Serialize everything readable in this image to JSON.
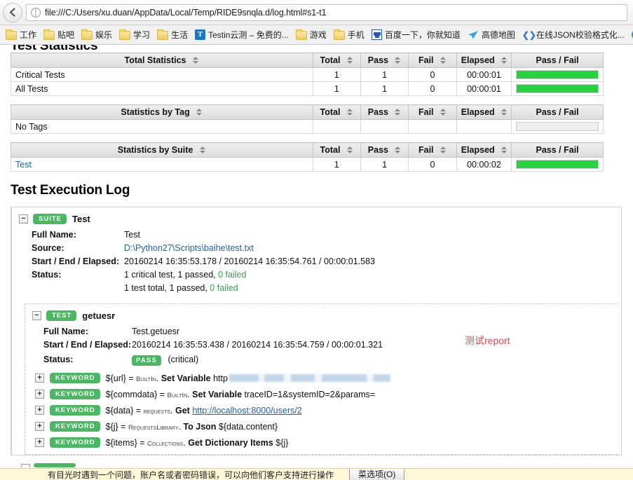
{
  "browser": {
    "back_button": "back-arrow",
    "url": "file:///C:/Users/xu.duan/AppData/Local/Temp/RIDE9snqla.d/log.html#s1-t1",
    "bookmarks": [
      {
        "label": "工作",
        "icon": "folder-icon"
      },
      {
        "label": "贴吧",
        "icon": "folder-icon"
      },
      {
        "label": "娱乐",
        "icon": "folder-icon"
      },
      {
        "label": "学习",
        "icon": "folder-icon"
      },
      {
        "label": "生活",
        "icon": "folder-icon"
      },
      {
        "label": "Testin云测 – 免费的...",
        "icon": "testin-icon"
      },
      {
        "label": "游戏",
        "icon": "folder-icon"
      },
      {
        "label": "手机",
        "icon": "folder-icon"
      },
      {
        "label": "百度一下，你就知道",
        "icon": "baidu-icon"
      },
      {
        "label": "高德地图",
        "icon": "amap-icon"
      },
      {
        "label": "在线JSON校验格式化...",
        "icon": "json-icon"
      },
      {
        "label": "",
        "icon": "google-icon"
      }
    ]
  },
  "page": {
    "statistics_title": "Test Statistics",
    "execution_title": "Test Execution Log",
    "annotation": "测试report"
  },
  "tables": [
    {
      "name": "total-statistics",
      "headers": [
        "Total Statistics",
        "Total",
        "Pass",
        "Fail",
        "Elapsed",
        "Pass / Fail"
      ],
      "rows": [
        {
          "name": "Critical Tests",
          "total": "1",
          "pass": "1",
          "fail": "0",
          "elapsed": "00:00:01",
          "pass_pct": 100,
          "link": false
        },
        {
          "name": "All Tests",
          "total": "1",
          "pass": "1",
          "fail": "0",
          "elapsed": "00:00:01",
          "pass_pct": 100,
          "link": false
        }
      ]
    },
    {
      "name": "statistics-by-tag",
      "headers": [
        "Statistics by Tag",
        "Total",
        "Pass",
        "Fail",
        "Elapsed",
        "Pass / Fail"
      ],
      "rows": [
        {
          "name": "No Tags",
          "total": "",
          "pass": "",
          "fail": "",
          "elapsed": "",
          "pass_pct": 0,
          "link": false
        }
      ]
    },
    {
      "name": "statistics-by-suite",
      "headers": [
        "Statistics by Suite",
        "Total",
        "Pass",
        "Fail",
        "Elapsed",
        "Pass / Fail"
      ],
      "rows": [
        {
          "name": "Test",
          "total": "1",
          "pass": "1",
          "fail": "0",
          "elapsed": "00:00:02",
          "pass_pct": 100,
          "link": true
        }
      ]
    }
  ],
  "suite": {
    "badge": "SUITE",
    "name": "Test",
    "expander": "−",
    "labels": {
      "full_name": "Full Name:",
      "source": "Source:",
      "start_end": "Start / End / Elapsed:",
      "status": "Status:"
    },
    "full_name": "Test",
    "source": "D:\\Python27\\Scripts\\baihe\\test.txt",
    "start_end_elapsed": "20160214 16:35:53.178 / 20160214 16:35:54.761 / 00:00:01.583",
    "status_line1_a": "1 critical test, 1 passed, ",
    "status_line1_b": "0 failed",
    "status_line2_a": "1 test total, 1 passed, ",
    "status_line2_b": "0 failed"
  },
  "test": {
    "badge": "TEST",
    "name": "getuesr",
    "expander": "−",
    "labels": {
      "full_name": "Full Name:",
      "start_end": "Start / End / Elapsed:",
      "status": "Status:"
    },
    "full_name": "Test.getuesr",
    "start_end_elapsed": "20160214 16:35:53.438 / 20160214 16:35:54.759 / 00:00:01.321",
    "status_badge": "PASS",
    "status_suffix": "(critical)"
  },
  "keywords": [
    {
      "badge": "KEYWORD",
      "expander": "+",
      "assign": "${url} = ",
      "library": "BuiltIn",
      "dot": ". ",
      "kwname": "Set Variable",
      "arg": "http",
      "redacted": true,
      "url": ""
    },
    {
      "badge": "KEYWORD",
      "expander": "+",
      "assign": "${commdata} = ",
      "library": "BuiltIn",
      "dot": ". ",
      "kwname": "Set Variable",
      "arg": "traceID=1&systemID=2&params=",
      "redacted": false,
      "url": ""
    },
    {
      "badge": "KEYWORD",
      "expander": "+",
      "assign": "${data} = ",
      "library": "requests",
      "dot": ". ",
      "kwname": "Get",
      "arg": "",
      "redacted": false,
      "url": "http://localhost:8000/users/2"
    },
    {
      "badge": "KEYWORD",
      "expander": "+",
      "assign": "${j} = ",
      "library": "RequestsLibrary",
      "dot": ". ",
      "kwname": "To Json",
      "arg": "${data.content}",
      "redacted": false,
      "url": ""
    },
    {
      "badge": "KEYWORD",
      "expander": "+",
      "assign": "${items} = ",
      "library": "Collections",
      "dot": ". ",
      "kwname": "Get Dictionary Items",
      "arg": "${j}",
      "redacted": false,
      "url": ""
    }
  ],
  "infobar": {
    "text": "有目光时遇到一个问题，账户名或者密码错误，可以向他们客户支持进行操作",
    "button": "菜选项(O)"
  },
  "colors": {
    "pass_green": "#27d23f",
    "badge_green": "#4ab862",
    "link_blue": "#1b63b5",
    "annotation_red": "#e04a4a",
    "infobar_yellow": "#fdf7d8"
  }
}
